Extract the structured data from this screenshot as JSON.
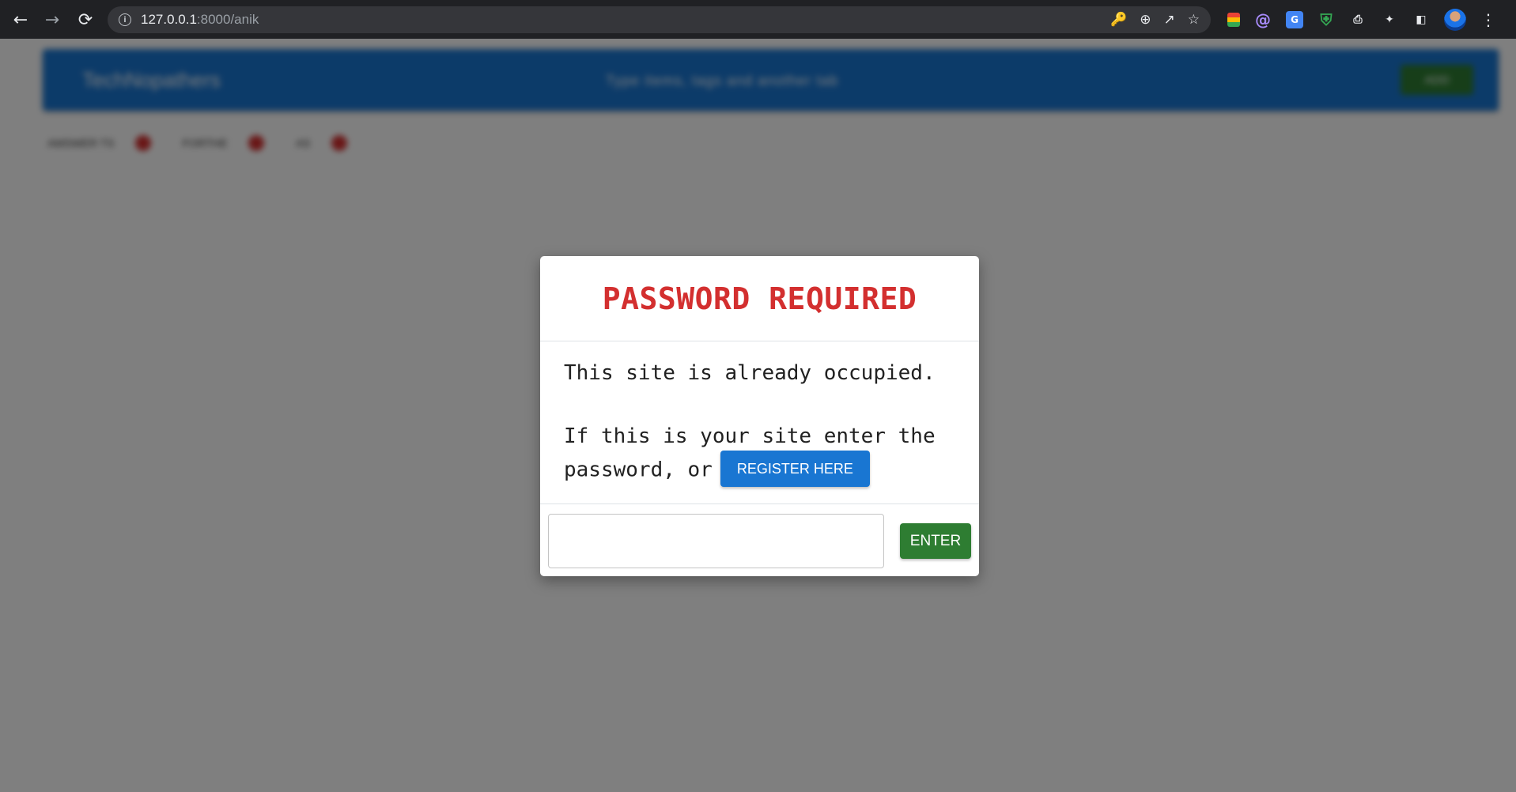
{
  "browser": {
    "url_host": "127.0.0.1",
    "url_rest": ":8000/anik"
  },
  "page": {
    "brand": "TechNopathers",
    "nav_text": "Type items, tags and another tab",
    "nav_button": "ADD",
    "tabs": [
      {
        "label": "AMSWER TS"
      },
      {
        "label": "FORTHE"
      },
      {
        "label": "AS"
      }
    ]
  },
  "modal": {
    "title": "PASSWORD REQUIRED",
    "line1": "This site is already occupied.",
    "line2": "If this is your site enter the",
    "line3": "password, or",
    "register_label": "REGISTER HERE",
    "password_value": "",
    "enter_label": "ENTER"
  },
  "colors": {
    "title_red": "#d32f2f",
    "register_blue": "#1976d2",
    "enter_green": "#2e7d32"
  }
}
